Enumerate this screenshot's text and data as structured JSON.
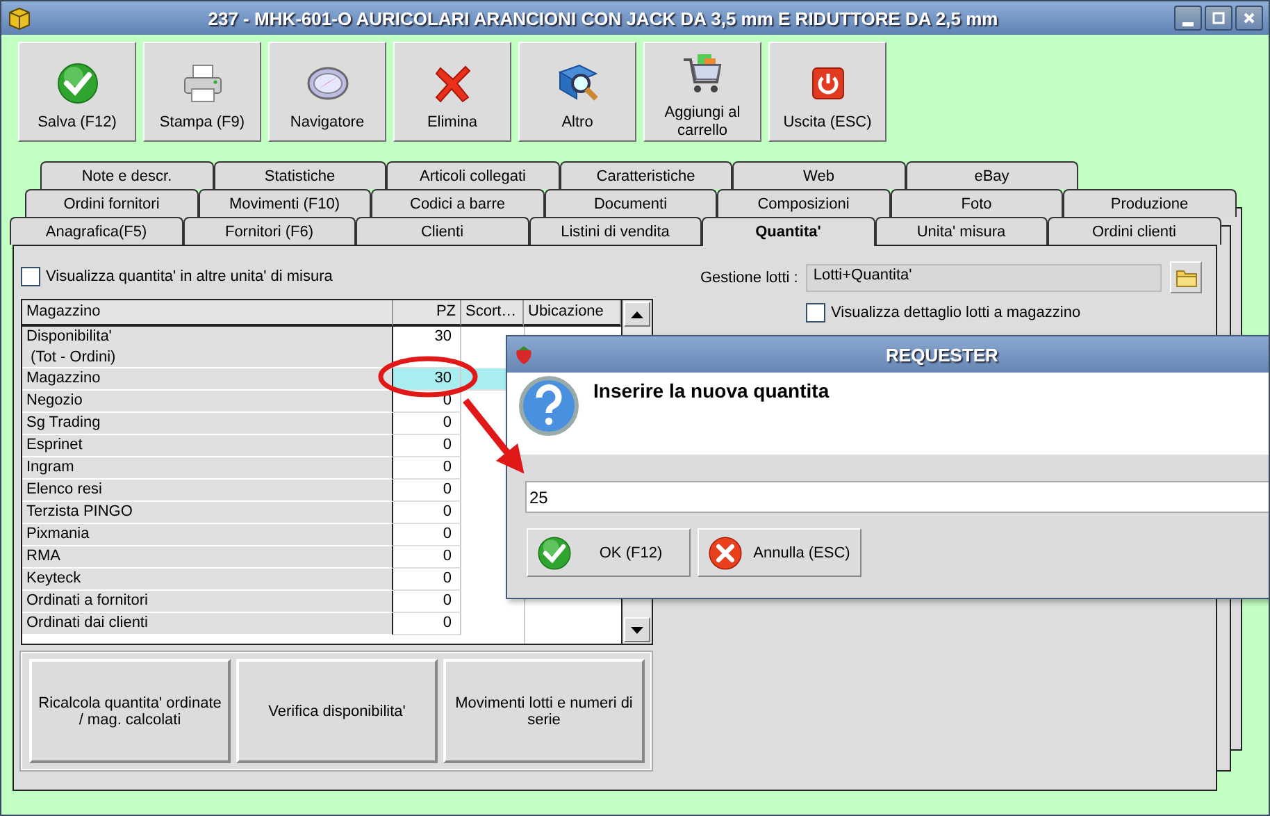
{
  "window": {
    "title": "237 - MHK-601-O AURICOLARI ARANCIONI CON JACK DA 3,5 mm E RIDUTTORE DA 2,5 mm"
  },
  "toolbar": [
    {
      "label": "Salva (F12)",
      "kind": "save"
    },
    {
      "label": "Stampa (F9)",
      "kind": "print"
    },
    {
      "label": "Navigatore",
      "kind": "compass"
    },
    {
      "label": "Elimina",
      "kind": "delete"
    },
    {
      "label": "Altro",
      "kind": "search"
    },
    {
      "label": "Aggiungi al carrello",
      "kind": "cart"
    },
    {
      "label": "Uscita (ESC)",
      "kind": "exit"
    }
  ],
  "tabs": [
    [
      {
        "label": "Note e descr.",
        "selected": false
      },
      {
        "label": "Statistiche",
        "selected": false
      },
      {
        "label": "Articoli collegati",
        "selected": false
      },
      {
        "label": "Caratteristiche",
        "selected": false
      },
      {
        "label": "Web",
        "selected": false
      },
      {
        "label": "eBay",
        "selected": false
      }
    ],
    [
      {
        "label": "Ordini fornitori",
        "selected": false
      },
      {
        "label": "Movimenti (F10)",
        "selected": false
      },
      {
        "label": "Codici a barre",
        "selected": false
      },
      {
        "label": "Documenti",
        "selected": false
      },
      {
        "label": "Composizioni",
        "selected": false
      },
      {
        "label": "Foto",
        "selected": false
      },
      {
        "label": "Produzione",
        "selected": false
      }
    ],
    [
      {
        "label": "Anagrafica(F5)",
        "selected": false
      },
      {
        "label": "Fornitori (F6)",
        "selected": false
      },
      {
        "label": "Clienti",
        "selected": false
      },
      {
        "label": "Listini di vendita",
        "selected": false
      },
      {
        "label": "Quantita'",
        "selected": true
      },
      {
        "label": "Unita' misura",
        "selected": false
      },
      {
        "label": "Ordini clienti",
        "selected": false
      }
    ]
  ],
  "other_units": {
    "label": "Visualizza quantita' in altre unita' di misura",
    "checked": false
  },
  "lots": {
    "label": "Gestione lotti :",
    "value": "Lotti+Quantita'"
  },
  "lot_detail": {
    "label": "Visualizza dettaglio lotti a magazzino",
    "checked": false
  },
  "table": {
    "columns": [
      "Magazzino",
      "PZ",
      "Scort…",
      "Ubicazione"
    ],
    "rows": [
      {
        "name": "Disponibilita'\n (Tot - Ordini)",
        "pz": "30",
        "selected": false
      },
      {
        "name": "Magazzino",
        "pz": "30",
        "selected": true
      },
      {
        "name": "Negozio",
        "pz": "0",
        "selected": false
      },
      {
        "name": "Sg Trading",
        "pz": "0",
        "selected": false
      },
      {
        "name": "Esprinet",
        "pz": "0",
        "selected": false
      },
      {
        "name": "Ingram",
        "pz": "0",
        "selected": false
      },
      {
        "name": "Elenco resi",
        "pz": "0",
        "selected": false
      },
      {
        "name": "Terzista PINGO",
        "pz": "0",
        "selected": false
      },
      {
        "name": "Pixmania",
        "pz": "0",
        "selected": false
      },
      {
        "name": "RMA",
        "pz": "0",
        "selected": false
      },
      {
        "name": "Keyteck",
        "pz": "0",
        "selected": false
      },
      {
        "name": "Ordinati a fornitori",
        "pz": "0",
        "selected": false
      },
      {
        "name": "Ordinati dai clienti",
        "pz": "0",
        "selected": false
      }
    ]
  },
  "actions": [
    "Ricalcola quantita' ordinate / mag. calcolati",
    "Verifica disponibilita'",
    "Movimenti lotti e numeri di serie"
  ],
  "dialog": {
    "title": "REQUESTER",
    "message": "Inserire la nuova quantita",
    "input": {
      "value": "25"
    },
    "buttons": [
      {
        "label": "OK (F12)",
        "kind": "ok"
      },
      {
        "label": "Annulla (ESC)",
        "kind": "cancel"
      }
    ]
  }
}
